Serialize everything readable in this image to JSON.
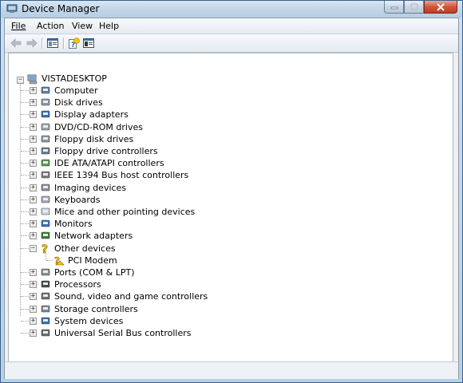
{
  "window": {
    "title": "Device Manager"
  },
  "menu": [
    "File",
    "Action",
    "View",
    "Help"
  ],
  "toolbar": {
    "buttons": [
      "back-arrow-icon",
      "forward-arrow-icon",
      "show-hide-console-tree-icon",
      "help-icon",
      "properties-icon"
    ]
  },
  "tree": {
    "root": "VISTADESKTOP",
    "categories": [
      "Computer",
      "Disk drives",
      "Display adapters",
      "DVD/CD-ROM drives",
      "Floppy disk drives",
      "Floppy drive controllers",
      "IDE ATA/ATAPI controllers",
      "IEEE 1394 Bus host controllers",
      "Imaging devices",
      "Keyboards",
      "Mice and other pointing devices",
      "Monitors",
      "Network adapters",
      "Other devices",
      "Ports (COM & LPT)",
      "Processors",
      "Sound, video and game controllers",
      "Storage controllers",
      "System devices",
      "Universal Serial Bus controllers"
    ],
    "expanded_category": "Other devices",
    "other_devices_children": [
      "PCI Modem"
    ]
  },
  "colors": {
    "title_gradient_top": "#d8e6f2",
    "close_button": "#c23a22",
    "warning_yellow": "#f5c400"
  }
}
